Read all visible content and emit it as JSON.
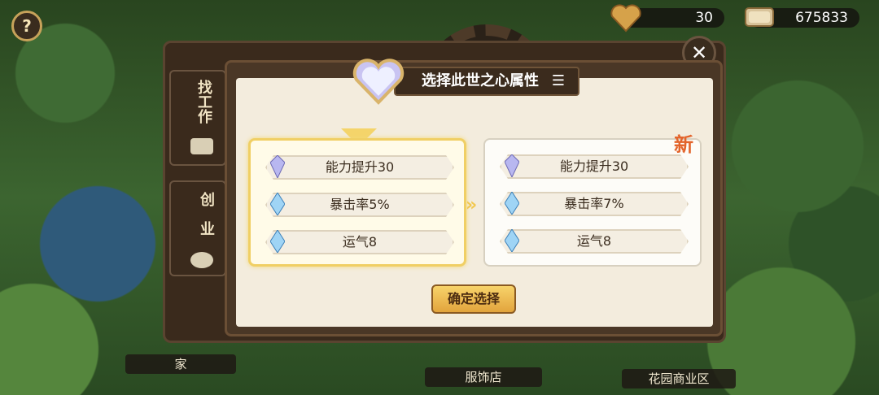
{
  "top_bar": {
    "hearts": "30",
    "coins": "675833"
  },
  "map_labels": [
    "家",
    "服饰店",
    "花园商业区"
  ],
  "side_tabs": {
    "job": "找工作",
    "startup": "创业"
  },
  "dialog": {
    "title": "选择此世之心属性",
    "new_badge": "新",
    "confirm_label": "确定选择",
    "current_attributes": [
      "能力提升30",
      "暴击率5%",
      "运气8"
    ],
    "new_attributes": [
      "能力提升30",
      "暴击率7%",
      "运气8"
    ]
  },
  "colors": {
    "selected_border": "#f0cf64",
    "new_badge": "#e3642b",
    "confirm_button": "#e2a43d"
  },
  "icons": [
    "help-icon",
    "heart-icon",
    "coin-stack-icon",
    "close-icon",
    "crystal-heart-icon",
    "gem-icon",
    "double-arrow-icon",
    "job-icon",
    "money-bag-icon"
  ]
}
